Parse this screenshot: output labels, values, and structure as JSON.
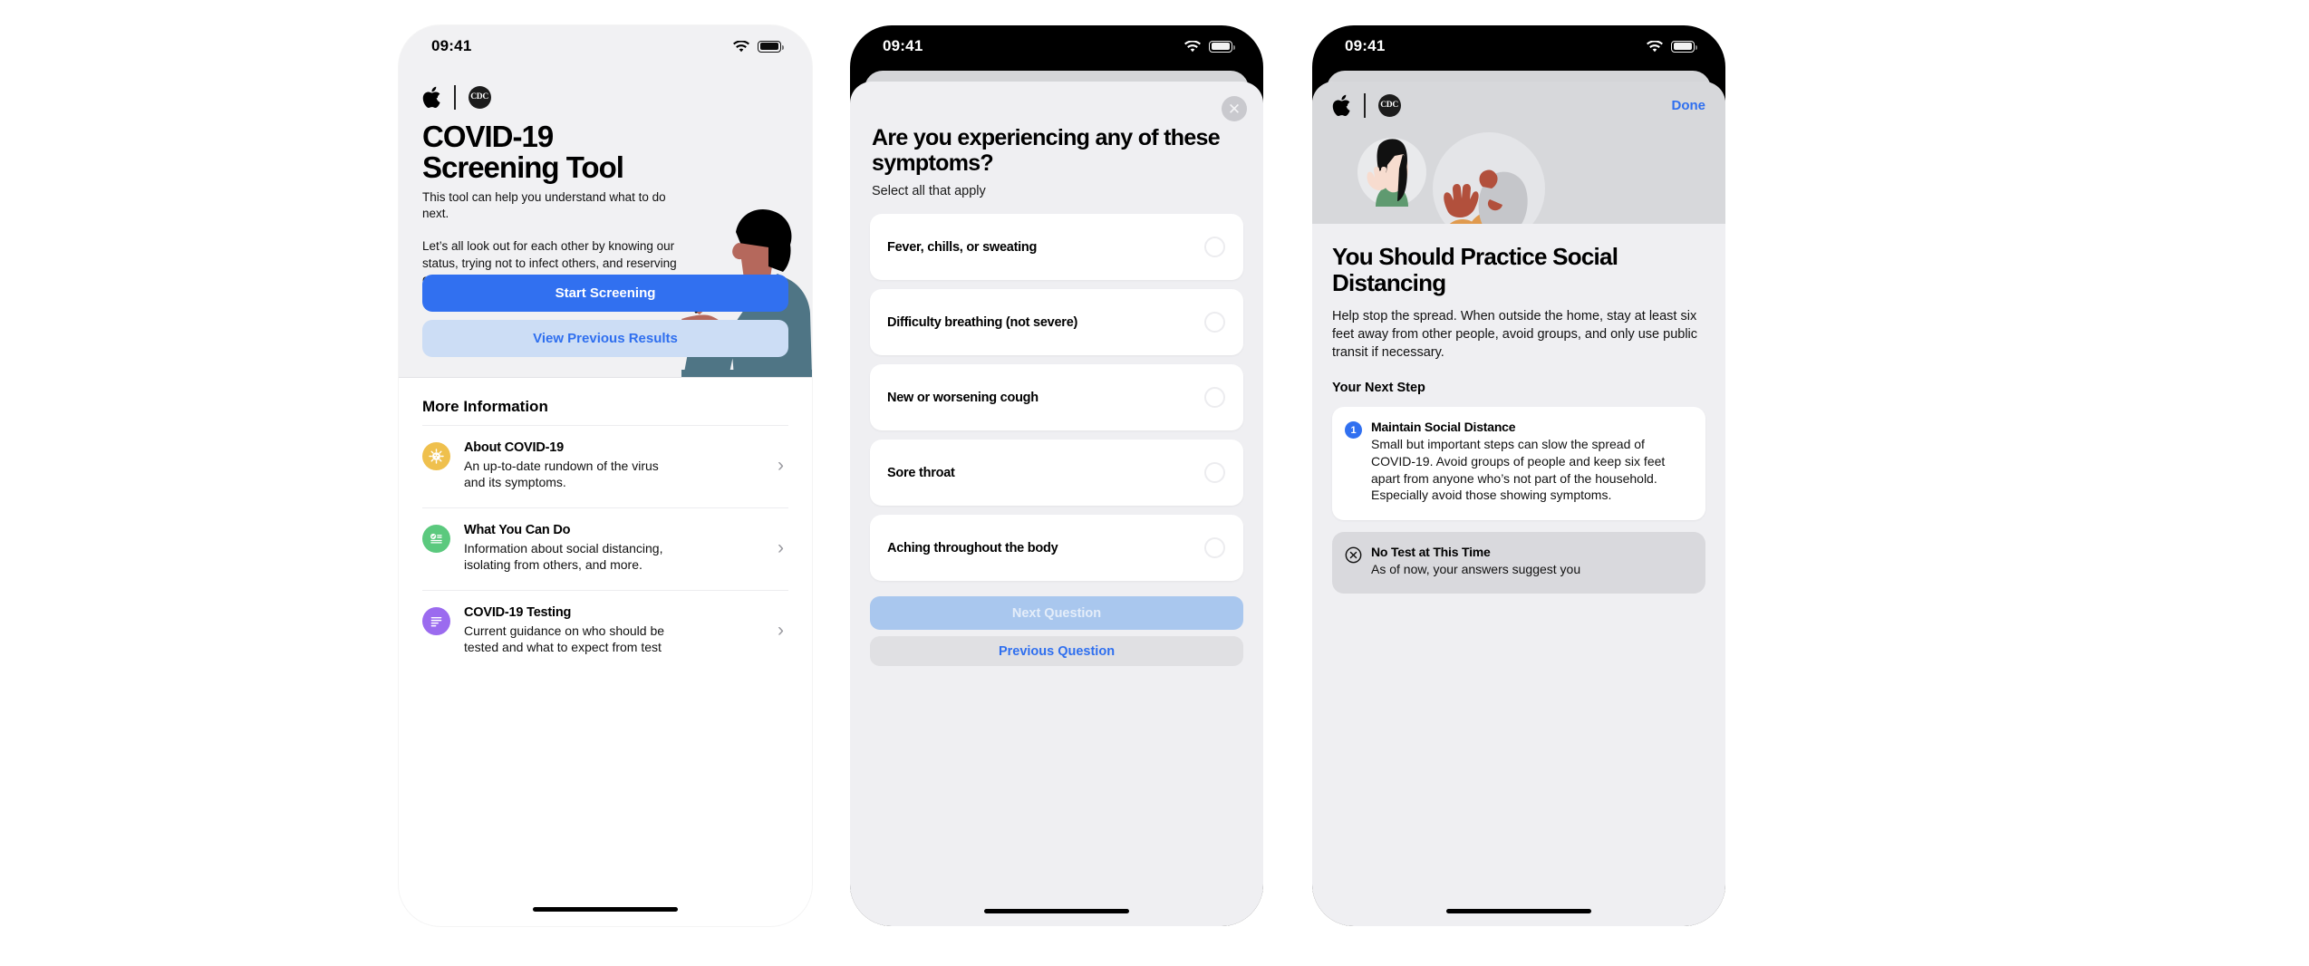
{
  "phone1": {
    "status": {
      "time": "09:41",
      "wifi_icon": "wifi-icon",
      "battery_icon": "battery-icon"
    },
    "brand": {
      "apple_icon": "apple-logo-icon",
      "cdc_label": "CDC",
      "divider": "brand-divider"
    },
    "title_line1": "COVID-19",
    "title_line2": "Screening Tool",
    "lede": "This tool can help you understand what to do next.",
    "body": "Let’s all look out for each other by knowing our status, trying not to infect others, and reserving care for those in need.",
    "primary_button": "Start Screening",
    "secondary_button": "View Previous Results",
    "more_info_title": "More Information",
    "more_info": [
      {
        "title": "About COVID-19",
        "desc": "An up-to-date rundown of the virus and its symptoms.",
        "icon": "virus-icon",
        "color": "#EFC04D"
      },
      {
        "title": "What You Can Do",
        "desc": "Information about social distancing, isolating from others, and more.",
        "icon": "checklist-icon",
        "color": "#5BC97E"
      },
      {
        "title": "COVID-19 Testing",
        "desc": "Current guidance on who should be tested and what to expect from test",
        "icon": "document-lines-icon",
        "color": "#9B6BEF"
      }
    ],
    "chevron_icon": "chevron-right-icon"
  },
  "phone2": {
    "status": {
      "time": "09:41",
      "wifi_icon": "wifi-icon",
      "battery_icon": "battery-icon"
    },
    "close_icon": "close-icon",
    "question": "Are you experiencing any of these symptoms?",
    "subtitle": "Select all that apply",
    "symptoms": [
      {
        "label": "Fever, chills, or sweating",
        "selected": false
      },
      {
        "label": "Difficulty breathing (not severe)",
        "selected": false
      },
      {
        "label": "New or worsening cough",
        "selected": false
      },
      {
        "label": "Sore throat",
        "selected": false
      },
      {
        "label": "Aching throughout the body",
        "selected": false
      }
    ],
    "next_button": "Next Question",
    "prev_button": "Previous Question"
  },
  "phone3": {
    "status": {
      "time": "09:41",
      "wifi_icon": "wifi-icon",
      "battery_icon": "battery-icon"
    },
    "brand": {
      "apple_icon": "apple-logo-icon",
      "cdc_label": "CDC"
    },
    "done_button": "Done",
    "headline": "You Should Practice Social Distancing",
    "body": "Help stop the spread. When outside the home, stay at least six feet away from other people, avoid groups, and only use public transit if necessary.",
    "next_step_label": "Your Next Step",
    "step_card": {
      "number": "1",
      "title": "Maintain Social Distance",
      "desc": "Small but important steps can slow the spread of COVID-19. Avoid groups of people and keep six feet apart from anyone who’s not part of the household. Especially avoid those showing symptoms."
    },
    "notice_card": {
      "icon": "x-circle-icon",
      "title": "No Test at This Time",
      "desc": "As of now, your answers suggest you"
    }
  },
  "colors": {
    "accent_blue": "#3170F0",
    "link_blue": "#2F6FEF",
    "secondary_blue_bg": "#CCDDF5",
    "disabled_blue": "#A9C7EE",
    "sheet_bg": "#EFEFF2",
    "card_white": "#FFFFFF",
    "muted_card": "#D9D9DD",
    "phone1_bg": "#F1F1F3",
    "art_bg": "#D7D8DB"
  }
}
